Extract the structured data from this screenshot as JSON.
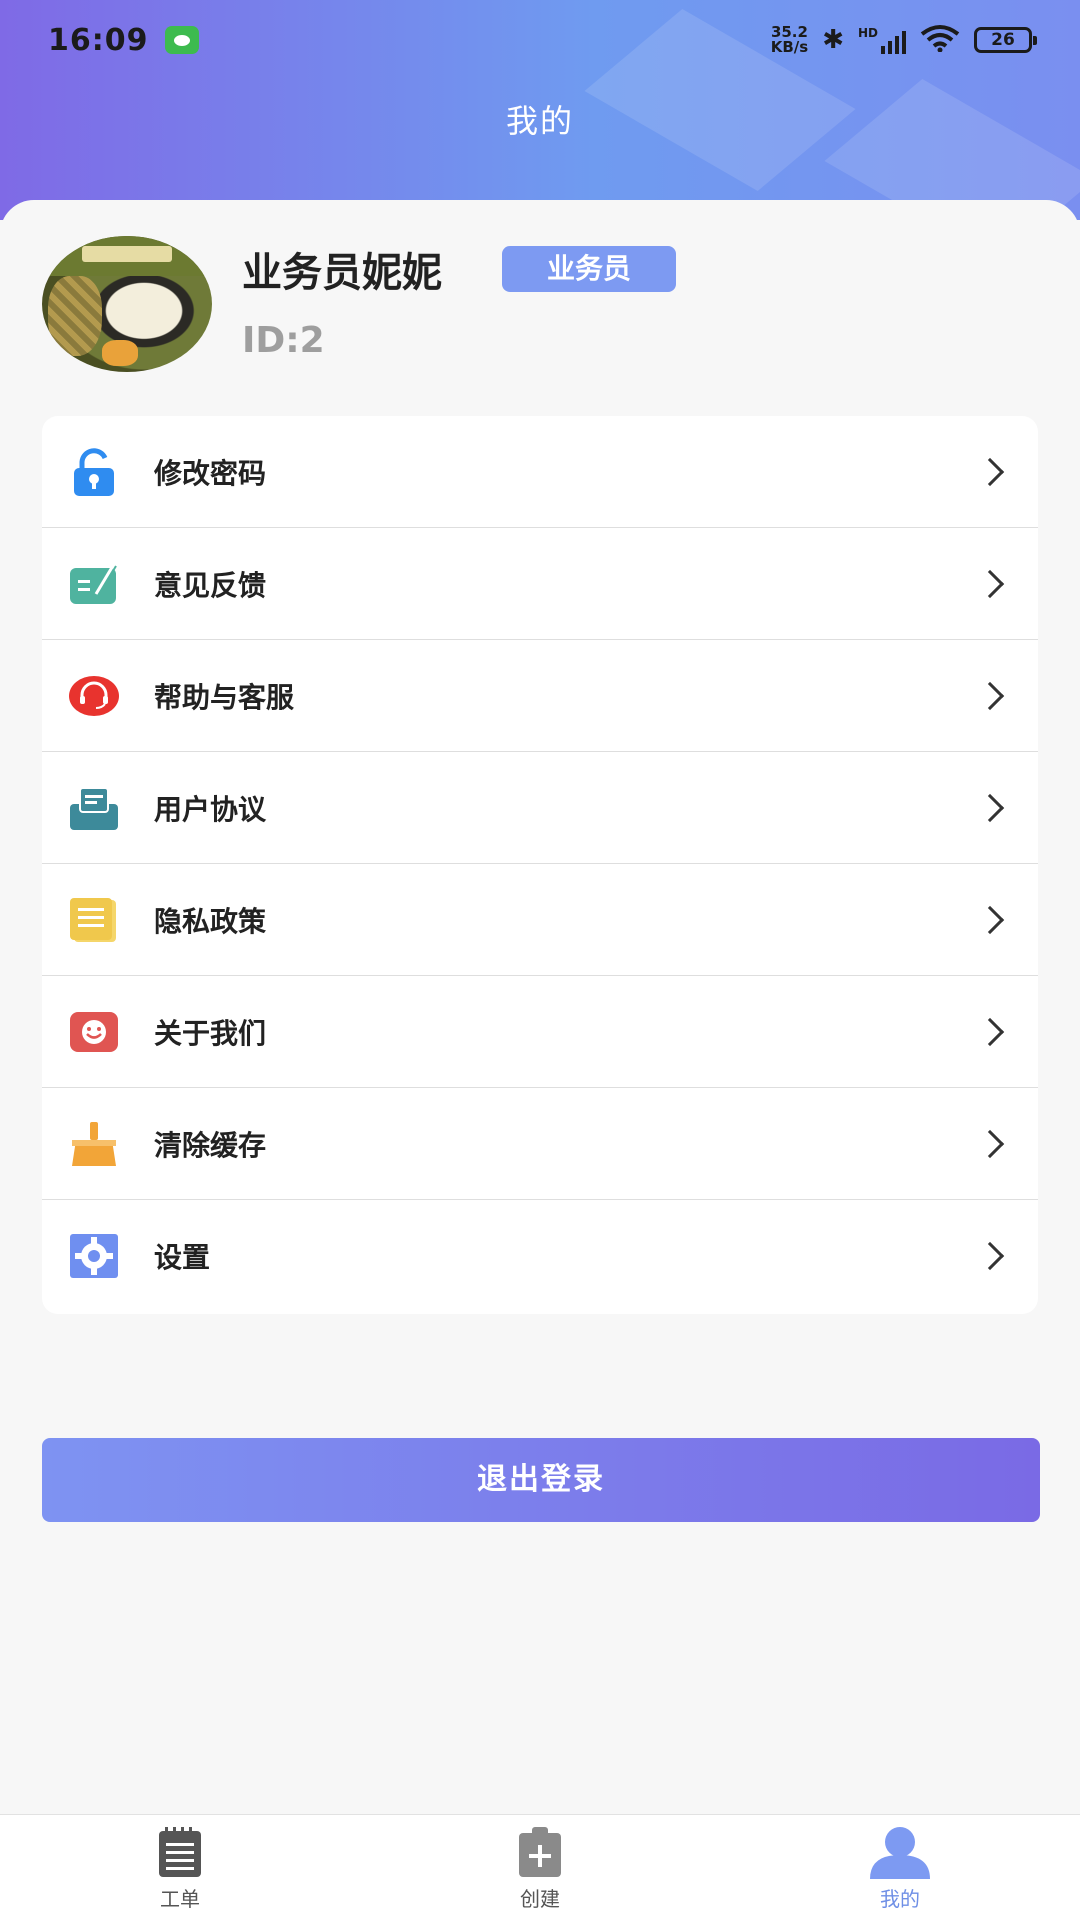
{
  "status_bar": {
    "time": "16:09",
    "net_speed_value": "35.2",
    "net_speed_unit": "KB/s",
    "signal_label": "HD",
    "battery": "26"
  },
  "header": {
    "title": "我的"
  },
  "profile": {
    "name": "业务员妮妮",
    "role": "业务员",
    "id": "ID:2"
  },
  "menu": {
    "items": [
      {
        "label": "修改密码",
        "icon": "unlock-icon",
        "color": "#2f8cf0"
      },
      {
        "label": "意见反馈",
        "icon": "feedback-icon",
        "color": "#4fb39f"
      },
      {
        "label": "帮助与客服",
        "icon": "headset-icon",
        "color": "#e8332e"
      },
      {
        "label": "用户协议",
        "icon": "agreement-icon",
        "color": "#3d8a9a"
      },
      {
        "label": "隐私政策",
        "icon": "document-icon",
        "color": "#f0c84c"
      },
      {
        "label": "关于我们",
        "icon": "smile-icon",
        "color": "#e05552"
      },
      {
        "label": "清除缓存",
        "icon": "broom-icon",
        "color": "#f2a538"
      },
      {
        "label": "设置",
        "icon": "gear-icon",
        "color": "#6f8ff0"
      }
    ]
  },
  "logout_label": "退出登录",
  "bottom_nav": {
    "items": [
      {
        "label": "工单",
        "icon": "notepad-icon"
      },
      {
        "label": "创建",
        "icon": "clipboard-plus-icon"
      },
      {
        "label": "我的",
        "icon": "user-icon"
      }
    ],
    "active": "我的"
  },
  "colors": {
    "accent": "#7d9af2",
    "header_gradient_start": "#7f6ae6",
    "header_gradient_end": "#6f9bf0"
  }
}
